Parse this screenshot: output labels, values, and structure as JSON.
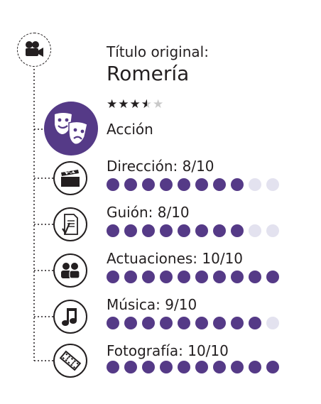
{
  "header": {
    "title_label": "Título original:",
    "title": "Romería",
    "rating": 3.5,
    "rating_max": 5,
    "genre": "Acción"
  },
  "criteria": [
    {
      "label": "Dirección: 8/10",
      "score": 8,
      "max": 10,
      "icon": "clapperboard-icon"
    },
    {
      "label": "Guión: 8/10",
      "score": 8,
      "max": 10,
      "icon": "script-icon"
    },
    {
      "label": "Actuaciones: 10/10",
      "score": 10,
      "max": 10,
      "icon": "actors-icon"
    },
    {
      "label": "Música: 9/10",
      "score": 9,
      "max": 10,
      "icon": "music-note-icon"
    },
    {
      "label": "Fotografía: 10/10",
      "score": 10,
      "max": 10,
      "icon": "film-strip-icon"
    }
  ],
  "colors": {
    "accent": "#553a87",
    "empty": "#e3e2ef",
    "ink": "#231f20",
    "star_empty": "#c9c9c9"
  }
}
